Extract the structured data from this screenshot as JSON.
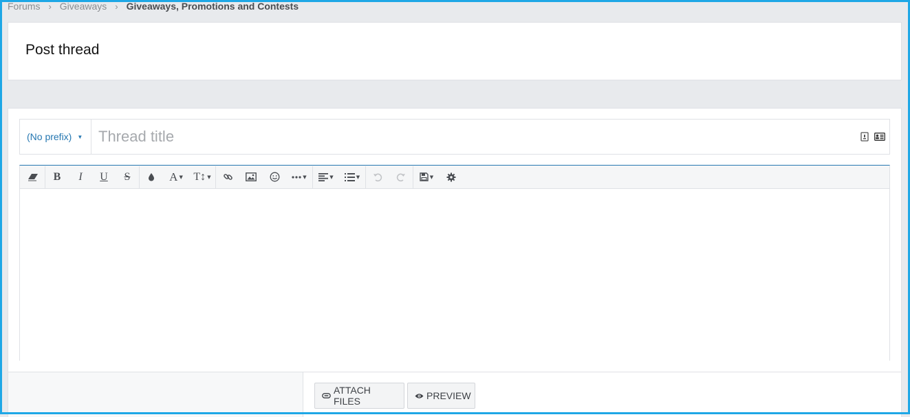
{
  "breadcrumb": {
    "items": [
      "Forums",
      "Giveaways"
    ],
    "current": "Giveaways, Promotions and Contests"
  },
  "page": {
    "title": "Post thread"
  },
  "form": {
    "prefix_label": "(No prefix)",
    "title_placeholder": "Thread title",
    "title_value": ""
  },
  "toolbar": {
    "buttons": [
      "eraser-icon",
      "bold-icon",
      "italic-icon",
      "underline-icon",
      "strikethrough-icon",
      "text-color-icon",
      "font-family-icon",
      "font-size-icon",
      "link-icon",
      "image-icon",
      "smilie-icon",
      "more-icon",
      "align-icon",
      "list-icon",
      "undo-icon",
      "redo-icon",
      "drafts-icon",
      "settings-icon"
    ]
  },
  "actions": {
    "attach_label": "ATTACH FILES",
    "preview_label": "PREVIEW"
  },
  "colors": {
    "accent": "#2577b1",
    "frame": "#1ea7e6",
    "page_bg": "#e8eaed"
  }
}
